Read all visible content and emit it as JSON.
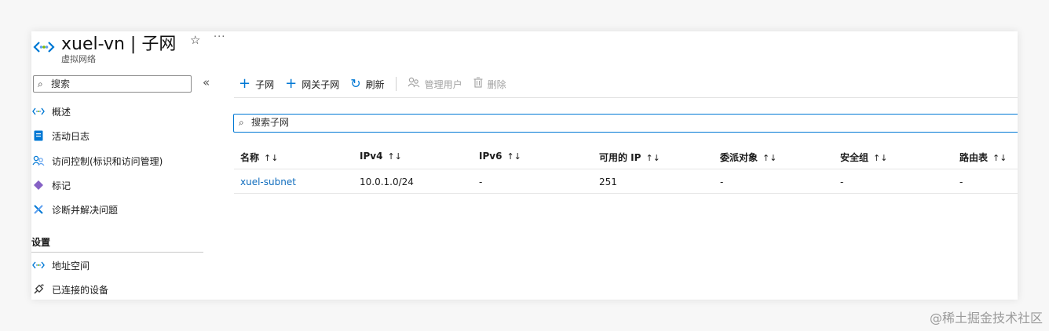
{
  "header": {
    "title": "xuel-vn | 子网",
    "subtitle": "虚拟网络",
    "star": "☆",
    "more": "···"
  },
  "sidebar": {
    "search_placeholder": "搜索",
    "collapse": "«",
    "items": [
      {
        "label": "概述",
        "icon": "vnet-icon"
      },
      {
        "label": "活动日志",
        "icon": "activity-log-icon"
      },
      {
        "label": "访问控制(标识和访问管理)",
        "icon": "people-icon"
      },
      {
        "label": "标记",
        "icon": "tag-icon"
      },
      {
        "label": "诊断并解决问题",
        "icon": "wrench-icon"
      }
    ],
    "section_title": "设置",
    "section_items": [
      {
        "label": "地址空间",
        "icon": "vnet-icon"
      },
      {
        "label": "已连接的设备",
        "icon": "plug-icon"
      }
    ]
  },
  "toolbar": {
    "add_subnet": "子网",
    "add_gateway_subnet": "网关子网",
    "refresh": "刷新",
    "manage_users": "管理用户",
    "delete": "删除"
  },
  "main": {
    "search_placeholder": "搜索子网"
  },
  "table": {
    "columns": [
      "名称",
      "IPv4",
      "IPv6",
      "可用的 IP",
      "委派对象",
      "安全组",
      "路由表"
    ],
    "sort_glyph": "↑↓",
    "rows": [
      [
        "xuel-subnet",
        "10.0.1.0/24",
        "-",
        "251",
        "-",
        "-",
        "-"
      ]
    ]
  },
  "watermark": "@稀土掘金技术社区",
  "colors": {
    "accent": "#0078d4",
    "link": "#0f6cbd",
    "tag": "#8661c5"
  }
}
